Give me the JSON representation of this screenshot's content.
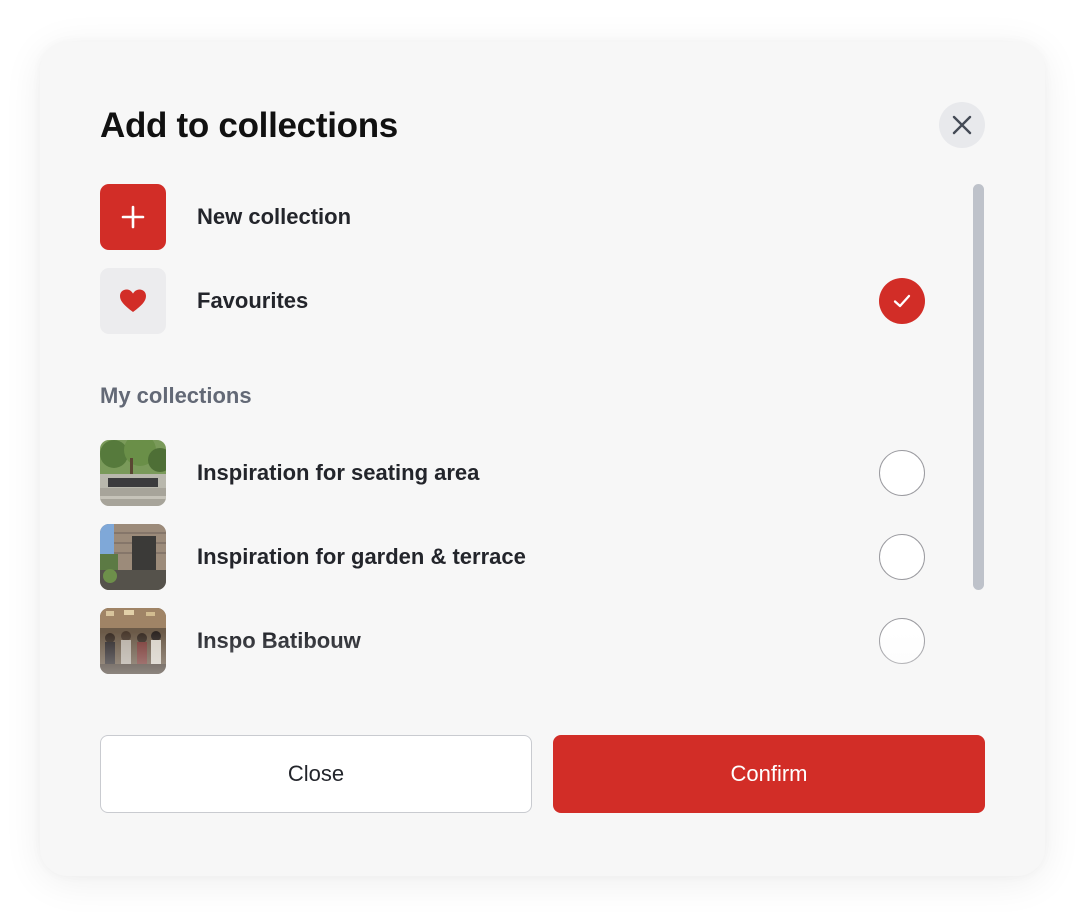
{
  "dialog": {
    "title": "Add to collections",
    "close_icon": "close-icon"
  },
  "new_collection": {
    "label": "New collection",
    "icon": "plus-icon"
  },
  "favourites": {
    "label": "Favourites",
    "icon": "heart-icon",
    "checked": true
  },
  "my_collections": {
    "heading": "My collections",
    "items": [
      {
        "label": "Inspiration for seating area",
        "checked": false
      },
      {
        "label": "Inspiration for garden & terrace",
        "checked": false
      },
      {
        "label": "Inspo Batibouw",
        "checked": false
      }
    ]
  },
  "footer": {
    "close_label": "Close",
    "confirm_label": "Confirm"
  },
  "colors": {
    "accent": "#d22d27",
    "background": "#f7f7f7",
    "text": "#23252b",
    "muted": "#636976"
  }
}
